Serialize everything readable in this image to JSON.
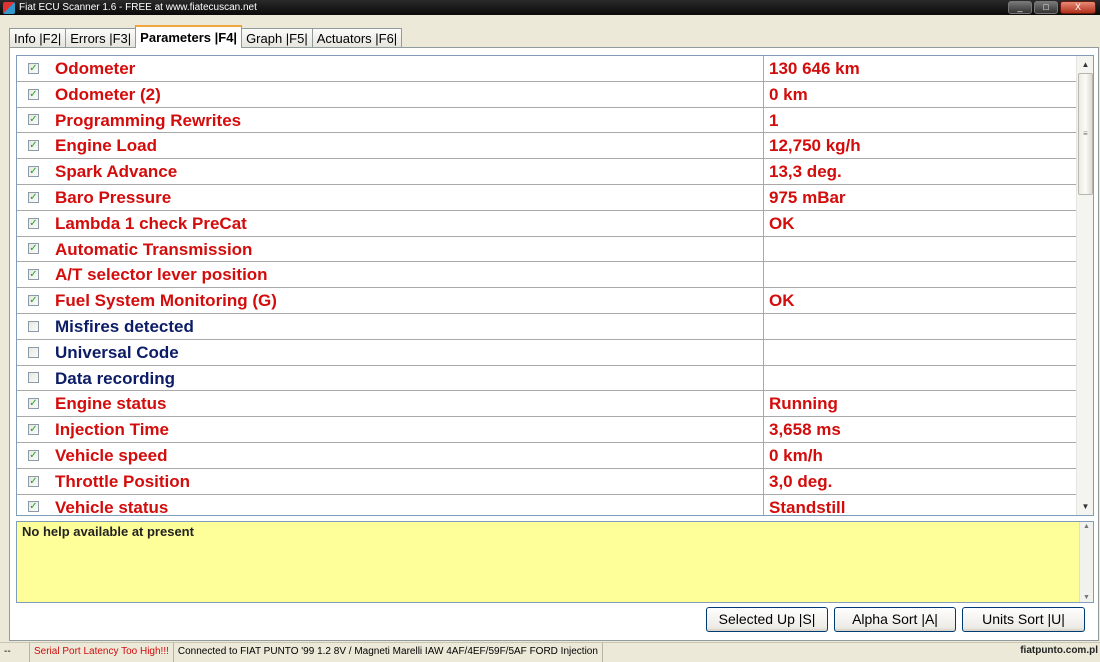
{
  "window": {
    "title": "Fiat ECU Scanner 1.6 - FREE at www.fiatecuscan.net",
    "controls": {
      "minimize": "_",
      "maximize": "□",
      "close": "X"
    }
  },
  "tabs": [
    {
      "label": "Info |F2|"
    },
    {
      "label": "Errors |F3|"
    },
    {
      "label": "Parameters |F4|",
      "active": true
    },
    {
      "label": "Graph |F5|"
    },
    {
      "label": "Actuators |F6|"
    }
  ],
  "parameters": [
    {
      "checked": true,
      "name": "Odometer",
      "value": "130 646 km"
    },
    {
      "checked": true,
      "name": "Odometer (2)",
      "value": "0 km"
    },
    {
      "checked": true,
      "name": "Programming Rewrites",
      "value": "1"
    },
    {
      "checked": true,
      "name": "Engine Load",
      "value": "12,750 kg/h"
    },
    {
      "checked": true,
      "name": "Spark Advance",
      "value": "13,3 deg."
    },
    {
      "checked": true,
      "name": "Baro Pressure",
      "value": "975 mBar"
    },
    {
      "checked": true,
      "name": "Lambda 1 check PreCat",
      "value": "OK"
    },
    {
      "checked": true,
      "name": "Automatic Transmission",
      "value": ""
    },
    {
      "checked": true,
      "name": "A/T selector lever position",
      "value": ""
    },
    {
      "checked": true,
      "name": "Fuel System Monitoring (G)",
      "value": "OK"
    },
    {
      "checked": false,
      "name": "Misfires detected",
      "value": ""
    },
    {
      "checked": false,
      "name": "Universal Code",
      "value": ""
    },
    {
      "checked": false,
      "name": "Data recording",
      "value": ""
    },
    {
      "checked": true,
      "name": "Engine status",
      "value": "Running"
    },
    {
      "checked": true,
      "name": "Injection Time",
      "value": "3,658 ms"
    },
    {
      "checked": true,
      "name": "Vehicle speed",
      "value": "0 km/h"
    },
    {
      "checked": true,
      "name": "Throttle Position",
      "value": "3,0 deg."
    },
    {
      "checked": true,
      "name": "Vehicle status",
      "value": "Standstill"
    }
  ],
  "help": {
    "text": "No help available at present"
  },
  "buttons": {
    "selected_up": "Selected Up |S|",
    "alpha_sort": "Alpha Sort |A|",
    "units_sort": "Units Sort |U|"
  },
  "status": {
    "indicator": "--",
    "latency_warning": "Serial Port Latency Too High!!!",
    "connection": "Connected to FIAT PUNTO '99 1.2 8V / Magneti Marelli IAW 4AF/4EF/59F/5AF FORD Injection"
  },
  "watermark": "fiatpunto.com.pl",
  "colors": {
    "enabled_text": "#d30c0c",
    "disabled_text": "#0c1c66",
    "help_bg": "#ffff99"
  }
}
